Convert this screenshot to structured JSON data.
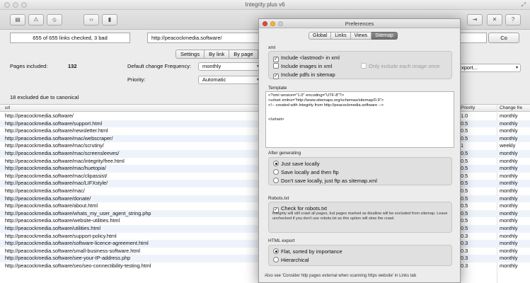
{
  "window": {
    "title": "Integrity plus v6"
  },
  "status": {
    "links_checked": "655 of 655 links checked, 3 bad"
  },
  "url_field": {
    "value": "http://peacockmedia.software/"
  },
  "go_label": "Co",
  "view_tabs": [
    "Settings",
    "By link",
    "By page"
  ],
  "settings": {
    "pages_included_label": "Pages included:",
    "pages_included_value": "132",
    "change_freq_label": "Default change Frequency:",
    "change_freq_value": "monthly",
    "priority_label": "Priority:",
    "priority_value": "Automatic",
    "export_value": "Export..."
  },
  "excluded_text": "18 excluded due to canonical",
  "table": {
    "headers": {
      "url": "url",
      "priority": "Priority",
      "change": "Change fre"
    },
    "rows": [
      {
        "url": "http://peacockmedia.software/",
        "priority": "1.0",
        "change": "monthly"
      },
      {
        "url": "http://peacockmedia.software/support.html",
        "priority": "0.5",
        "change": "monthly"
      },
      {
        "url": "http://peacockmedia.software/newsletter.html",
        "priority": "0.5",
        "change": "monthly"
      },
      {
        "url": "http://peacockmedia.software/mac/webscraper/",
        "priority": "0.5",
        "change": "monthly"
      },
      {
        "url": "http://peacockmedia.software/mac/scrutiny/",
        "priority": "1",
        "change": "weekly"
      },
      {
        "url": "http://peacockmedia.software/mac/screensleeves/",
        "priority": "0.5",
        "change": "monthly"
      },
      {
        "url": "http://peacockmedia.software/mac/integrity/free.html",
        "priority": "0.5",
        "change": "monthly"
      },
      {
        "url": "http://peacockmedia.software/mac/huetopia/",
        "priority": "0.5",
        "change": "monthly"
      },
      {
        "url": "http://peacockmedia.software/mac/clipassist/",
        "priority": "0.5",
        "change": "monthly"
      },
      {
        "url": "http://peacockmedia.software/mac/LIFXstyle/",
        "priority": "0.5",
        "change": "monthly"
      },
      {
        "url": "http://peacockmedia.software/mac/",
        "priority": "0.5",
        "change": "monthly"
      },
      {
        "url": "http://peacockmedia.software/donate/",
        "priority": "0.5",
        "change": "monthly"
      },
      {
        "url": "http://peacockmedia.software/about.html",
        "priority": "0.5",
        "change": "monthly"
      },
      {
        "url": "http://peacockmedia.software/whats_my_user_agent_string.php",
        "priority": "0.5",
        "change": "monthly"
      },
      {
        "url": "http://peacockmedia.software/website-utilities.html",
        "priority": "0.5",
        "change": "monthly"
      },
      {
        "url": "http://peacockmedia.software/utilities.html",
        "priority": "0.5",
        "change": "monthly"
      },
      {
        "url": "http://peacockmedia.software/support-policy.html",
        "priority": "0.3",
        "change": "monthly"
      },
      {
        "url": "http://peacockmedia.software/software-licence-agreement.html",
        "priority": "0.3",
        "change": "monthly"
      },
      {
        "url": "http://peacockmedia.software/small-business-software.html",
        "priority": "0.3",
        "change": "monthly"
      },
      {
        "url": "http://peacockmedia.software/see-your-IP-address.php",
        "priority": "0.3",
        "change": "monthly"
      },
      {
        "url": "http://peacockmedia.software/seo/seo-connectibility-testing.html",
        "priority": "0.3",
        "change": "monthly"
      }
    ]
  },
  "prefs": {
    "title": "Preferences",
    "tabs": [
      "Global",
      "Links",
      "Views",
      "Sitemap"
    ],
    "xml_label": "xml",
    "include_lastmod": "Include <lastmod> in xml",
    "include_images": "Include images in xml",
    "only_each_image": "Only include each image once",
    "include_pdfs": "Include pdfs in sitemap",
    "template_label": "Template",
    "template_lines": [
      "<?xml version=\"1.0\" encoding=\"UTF-8\"?>",
      "<urlset xmlns=\"http://www.sitemaps.org/schemas/sitemap/0.9\">",
      "<!-- created with Integrity from http://peacockmedia.software -->",
      "",
      "",
      "</urlset>"
    ],
    "after_label": "After generating",
    "just_save": "Just save locally",
    "save_ftp": "Save locally and then ftp",
    "dont_save": "Don't save locally, just ftp as sitemap.xml",
    "robots_label": "Robots.txt",
    "check_robots": "Check for robots.txt",
    "robots_note": "Integrity will still crawl all pages, but pages marked as disallow will be excluded from sitemap. Leave unchecked if you don't use robots.txt as this option will slow the crawl.",
    "html_label": "HTML export",
    "flat": "Flat, sorted by importance",
    "hierarchical": "Hierarchical",
    "footer_note": "Also see 'Consider http pages external when scanning https website' in Links tab"
  }
}
